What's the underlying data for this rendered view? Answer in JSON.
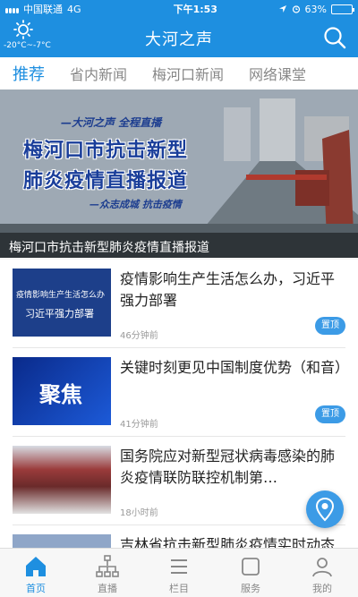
{
  "status_bar": {
    "carrier": "中国联通",
    "network": "4G",
    "time": "下午1:53",
    "battery": "63%",
    "battery_level": 0.63
  },
  "header": {
    "title": "大河之声",
    "weather_temp": "-20°C~-7°C",
    "weather_icon": "sun-icon",
    "search_icon": "search-icon"
  },
  "tabs": [
    {
      "label": "推荐",
      "active": true
    },
    {
      "label": "省内新闻",
      "active": false
    },
    {
      "label": "梅河口新闻",
      "active": false
    },
    {
      "label": "网络课堂",
      "active": false
    }
  ],
  "banner": {
    "slogan": "—大河之声 全程直播",
    "headline_line1": "梅河口市抗击新型",
    "headline_line2": "肺炎疫情直播报道",
    "sub": "—众志成城 抗击疫情",
    "caption": "梅河口市抗击新型肺炎疫情直播报道"
  },
  "news": [
    {
      "headline": "疫情影响生产生活怎么办，习近平强力部署",
      "time": "46分钟前",
      "pinned": "置顶",
      "thumb_text_top": "疫情影响生产生活怎么办",
      "thumb_text_bottom": "习近平强力部署"
    },
    {
      "headline": "关键时刻更见中国制度优势（和音）",
      "time": "41分钟前",
      "pinned": "置顶",
      "thumb_text_top": "聚焦"
    },
    {
      "headline": "国务院应对新型冠状病毒感染的肺炎疫情联防联控机制第…",
      "time": "18小时前"
    },
    {
      "headline": "吉林省抗击新型肺炎疫情实时动态"
    }
  ],
  "bottom_nav": [
    {
      "label": "首页",
      "icon": "home-icon",
      "active": true
    },
    {
      "label": "直播",
      "icon": "live-icon",
      "active": false
    },
    {
      "label": "栏目",
      "icon": "column-icon",
      "active": false
    },
    {
      "label": "服务",
      "icon": "service-icon",
      "active": false
    },
    {
      "label": "我的",
      "icon": "profile-icon",
      "active": false
    }
  ],
  "colors": {
    "primary": "#1e8fe0",
    "pin_badge": "#3c9be6"
  }
}
